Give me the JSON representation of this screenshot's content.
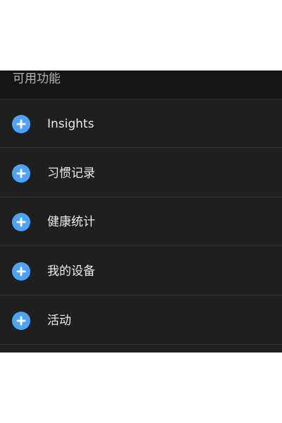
{
  "section": {
    "title": "可用功能"
  },
  "items": [
    {
      "label": "Insights",
      "icon": "add-circle-icon"
    },
    {
      "label": "习惯记录",
      "icon": "add-circle-icon"
    },
    {
      "label": "健康统计",
      "icon": "add-circle-icon"
    },
    {
      "label": "我的设备",
      "icon": "add-circle-icon"
    },
    {
      "label": "活动",
      "icon": "add-circle-icon"
    }
  ],
  "colors": {
    "background": "#1e1e1e",
    "header_background": "#141414",
    "accent": "#4da3f7",
    "text_primary": "#ececec",
    "text_secondary": "#b4b4b4"
  }
}
